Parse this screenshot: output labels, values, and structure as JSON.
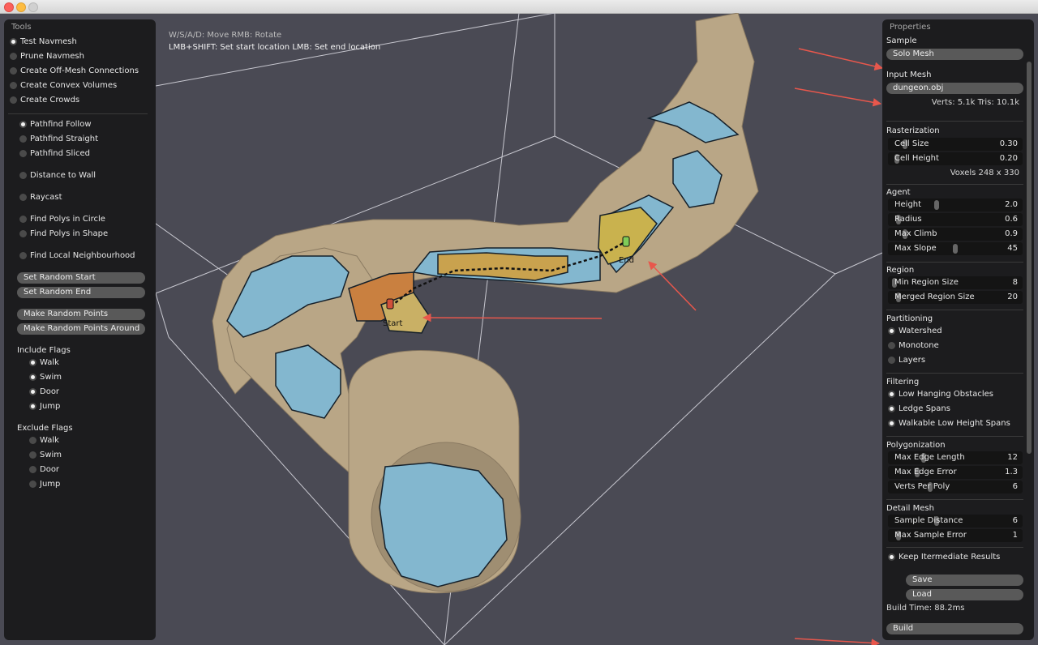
{
  "viewport": {
    "hint_line1": "W/S/A/D: Move  RMB: Rotate",
    "hint_line2": "LMB+SHIFT: Set start location  LMB: Set end location",
    "start_label": "Start",
    "end_label": "End"
  },
  "tools_panel": {
    "title": "Tools",
    "tools": [
      {
        "label": "Test Navmesh",
        "checked": true
      },
      {
        "label": "Prune Navmesh",
        "checked": false
      },
      {
        "label": "Create Off-Mesh Connections",
        "checked": false
      },
      {
        "label": "Create Convex Volumes",
        "checked": false
      },
      {
        "label": "Create Crowds",
        "checked": false
      }
    ],
    "modes": [
      {
        "label": "Pathfind Follow",
        "checked": true
      },
      {
        "label": "Pathfind Straight",
        "checked": false
      },
      {
        "label": "Pathfind Sliced",
        "checked": false
      },
      {
        "label": "Distance to Wall",
        "checked": false
      },
      {
        "label": "Raycast",
        "checked": false
      },
      {
        "label": "Find Polys in Circle",
        "checked": false
      },
      {
        "label": "Find Polys in Shape",
        "checked": false
      },
      {
        "label": "Find Local Neighbourhood",
        "checked": false
      }
    ],
    "buttons": [
      "Set Random Start",
      "Set Random End",
      "Make Random Points",
      "Make Random Points Around"
    ],
    "include_flags_title": "Include Flags",
    "include_flags": [
      {
        "label": "Walk",
        "checked": true
      },
      {
        "label": "Swim",
        "checked": true
      },
      {
        "label": "Door",
        "checked": true
      },
      {
        "label": "Jump",
        "checked": true
      }
    ],
    "exclude_flags_title": "Exclude Flags",
    "exclude_flags": [
      {
        "label": "Walk",
        "checked": false
      },
      {
        "label": "Swim",
        "checked": false
      },
      {
        "label": "Door",
        "checked": false
      },
      {
        "label": "Jump",
        "checked": false
      }
    ]
  },
  "properties_panel": {
    "title": "Properties",
    "sample_title": "Sample",
    "sample_value": "Solo Mesh",
    "input_mesh_title": "Input Mesh",
    "input_mesh_value": "dungeon.obj",
    "mesh_stats": "Verts: 5.1k  Tris: 10.1k",
    "rasterization_title": "Rasterization",
    "cell_size": {
      "label": "Cell Size",
      "value": "0.30",
      "level": 0.1
    },
    "cell_height": {
      "label": "Cell Height",
      "value": "0.20",
      "level": 0.04
    },
    "voxels": "Voxels  248 x 330",
    "agent_title": "Agent",
    "agent": [
      {
        "label": "Height",
        "value": "2.0",
        "level": 0.35
      },
      {
        "label": "Radius",
        "value": "0.6",
        "level": 0.05
      },
      {
        "label": "Max Climb",
        "value": "0.9",
        "level": 0.1
      },
      {
        "label": "Max Slope",
        "value": "45",
        "level": 0.5
      }
    ],
    "region_title": "Region",
    "region": [
      {
        "label": "Min Region Size",
        "value": "8",
        "level": 0.02
      },
      {
        "label": "Merged Region Size",
        "value": "20",
        "level": 0.05
      }
    ],
    "partitioning_title": "Partitioning",
    "partitioning": [
      {
        "label": "Watershed",
        "checked": true
      },
      {
        "label": "Monotone",
        "checked": false
      },
      {
        "label": "Layers",
        "checked": false
      }
    ],
    "filtering_title": "Filtering",
    "filtering": [
      {
        "label": "Low Hanging Obstacles",
        "checked": true
      },
      {
        "label": "Ledge Spans",
        "checked": true
      },
      {
        "label": "Walkable Low Height Spans",
        "checked": true
      }
    ],
    "polygonization_title": "Polygonization",
    "polygonization": [
      {
        "label": "Max Edge Length",
        "value": "12",
        "level": 0.25
      },
      {
        "label": "Max Edge Error",
        "value": "1.3",
        "level": 0.2
      },
      {
        "label": "Verts Per Poly",
        "value": "6",
        "level": 0.3
      }
    ],
    "detail_title": "Detail Mesh",
    "detail": [
      {
        "label": "Sample Distance",
        "value": "6",
        "level": 0.35
      },
      {
        "label": "Max Sample Error",
        "value": "1",
        "level": 0.05
      }
    ],
    "keep_intermediate": {
      "label": "Keep Itermediate Results",
      "checked": true
    },
    "save_label": "Save",
    "load_label": "Load",
    "build_time": "Build Time: 88.2ms",
    "build_label": "Build"
  },
  "colors": {
    "background": "#4a4a54",
    "panel": "#1c1c1e",
    "wall": "#b9a686",
    "navmesh": "#83b7cf",
    "path_poly": "#c9a24e",
    "start_poly": "#c98040",
    "annotation_arrow": "#e8574c"
  }
}
